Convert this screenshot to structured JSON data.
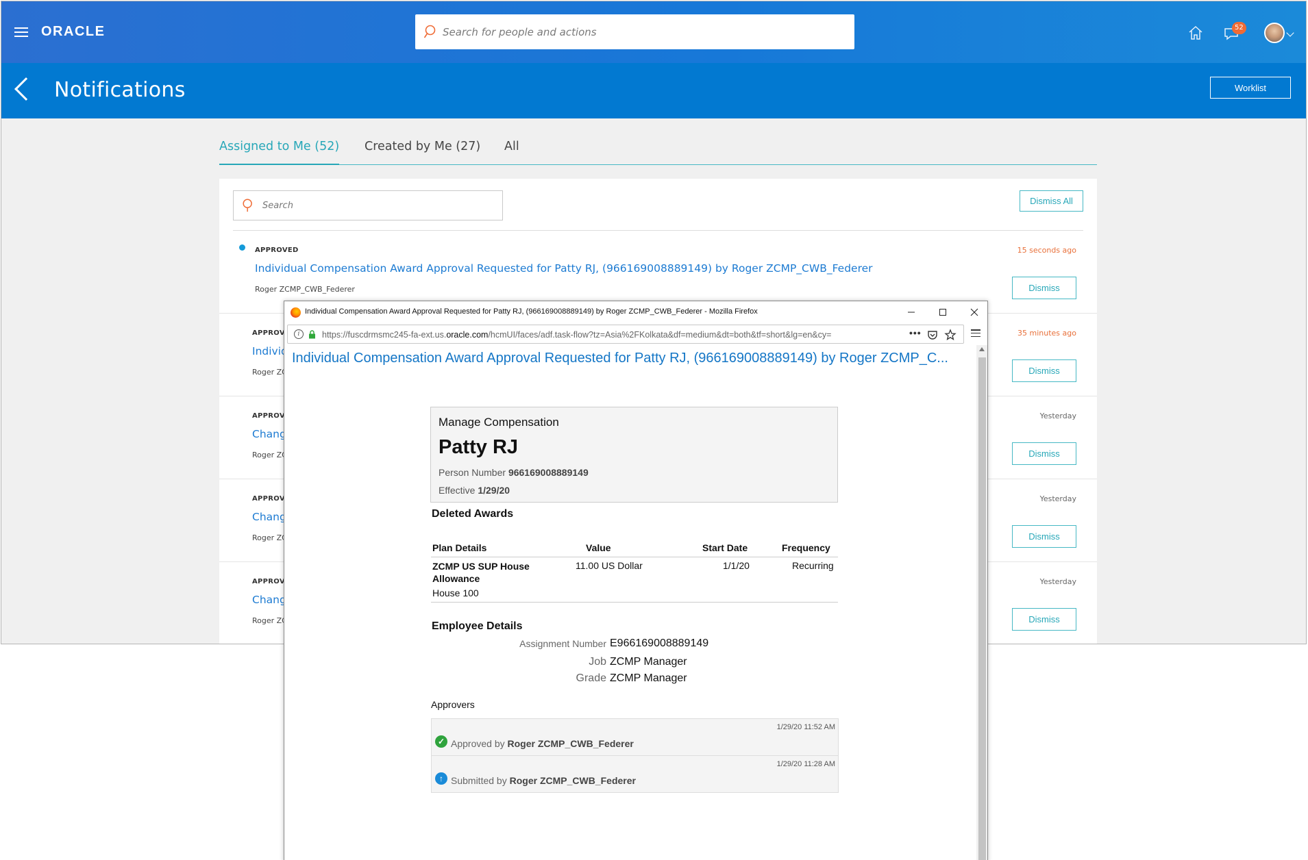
{
  "app": {
    "logo": "ORACLE",
    "search_placeholder": "Search for people and actions",
    "notification_count": "52",
    "page_title": "Notifications",
    "worklist_label": "Worklist"
  },
  "tabs": [
    {
      "label": "Assigned to Me (52)",
      "active": true
    },
    {
      "label": "Created by Me (27)",
      "active": false
    },
    {
      "label": "All",
      "active": false
    }
  ],
  "panel": {
    "search_placeholder": "Search",
    "dismiss_all_label": "Dismiss All",
    "dismiss_label": "Dismiss"
  },
  "notifications": [
    {
      "status": "APPROVED",
      "time": "15 seconds ago",
      "title": "Individual Compensation Award Approval Requested for Patty RJ, (966169008889149) by Roger ZCMP_CWB_Federer",
      "from": "Roger ZCMP_CWB_Federer",
      "unread": true
    },
    {
      "status": "APPROVE",
      "time": "35 minutes ago",
      "title": "Individ",
      "from": "Roger ZC",
      "unread": false
    },
    {
      "status": "APPROVE",
      "time": "Yesterday",
      "title": "Chang",
      "from": "Roger ZC",
      "unread": false
    },
    {
      "status": "APPROVE",
      "time": "Yesterday",
      "title": "Chang",
      "from": "Roger ZC",
      "unread": false
    },
    {
      "status": "APPROVE",
      "time": "Yesterday",
      "title": "Chang",
      "from": "Roger ZC",
      "unread": false
    }
  ],
  "firefox": {
    "window_title": "Individual Compensation Award Approval Requested for Patty RJ, (966169008889149) by Roger ZCMP_CWB_Federer - Mozilla Firefox",
    "url_prefix": "https://fuscdrmsmc245-fa-ext.us.",
    "url_domain": "oracle.com",
    "url_suffix": "/hcmUI/faces/adf.task-flow?tz=Asia%2FKolkata&df=medium&dt=both&tf=short&lg=en&cy=",
    "url_more": "•••"
  },
  "document": {
    "title": "Individual Compensation Award Approval Requested for Patty RJ, (966169008889149) by Roger ZCMP_C...",
    "card": {
      "heading": "Manage Compensation",
      "person_name": "Patty RJ",
      "person_number_label": "Person Number",
      "person_number": "966169008889149",
      "effective_label": "Effective",
      "effective": "1/29/20"
    },
    "deleted_awards_heading": "Deleted Awards",
    "awards_columns": [
      "Plan Details",
      "Value",
      "Start Date",
      "Frequency"
    ],
    "awards_rows": [
      {
        "plan": "ZCMP US SUP House Allowance",
        "sub": "House 100",
        "value": "11.00 US Dollar",
        "start_date": "1/1/20",
        "frequency": "Recurring"
      }
    ],
    "employee_details_heading": "Employee Details",
    "employee_details": [
      {
        "label": "Assignment Number",
        "value": "E966169008889149"
      },
      {
        "label": "Job",
        "value": "ZCMP Manager"
      },
      {
        "label": "Grade",
        "value": "ZCMP Manager"
      }
    ],
    "approvers_label": "Approvers",
    "approvers": [
      {
        "timestamp": "1/29/20 11:52 AM",
        "action": "Approved by",
        "person": "Roger ZCMP_CWB_Federer",
        "icon": "check-circle-icon"
      },
      {
        "timestamp": "1/29/20 11:28 AM",
        "action": "Submitted by",
        "person": "Roger ZCMP_CWB_Federer",
        "icon": "arrow-up-circle-icon"
      }
    ]
  },
  "colors": {
    "topbar": "#1778d8",
    "titlebar": "#0279d1",
    "accent_teal": "#27a7b8",
    "link_blue": "#1d7bd2",
    "time_recent": "#e8703a"
  }
}
